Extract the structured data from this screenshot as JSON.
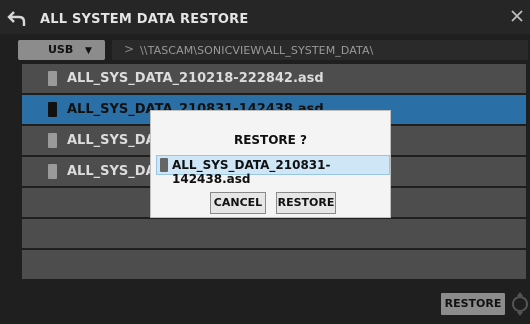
{
  "title": "ALL SYSTEM DATA RESTORE",
  "toolbar": {
    "usb_label": "USB",
    "dropdown_arrow": "▼",
    "path_separator": ">",
    "path": "\\\\TASCAM\\SONICVIEW\\ALL_SYSTEM_DATA\\"
  },
  "files": [
    {
      "name": "ALL_SYS_DATA_210218-222842.asd",
      "selected": false
    },
    {
      "name": "ALL_SYS_DATA_210831-142438.asd",
      "selected": true
    },
    {
      "name": "ALL_SYS_DAT",
      "selected": false
    },
    {
      "name": "ALL_SYS_DAT",
      "selected": false
    },
    {
      "name": "",
      "selected": false
    },
    {
      "name": "",
      "selected": false
    },
    {
      "name": "",
      "selected": false
    }
  ],
  "footer": {
    "restore_label": "RESTORE"
  },
  "dialog": {
    "title": "RESTORE ?",
    "file": "ALL_SYS_DATA_210831-142438.asd",
    "cancel_label": "CANCEL",
    "restore_label": "RESTORE"
  },
  "colors": {
    "background": "#1f1f1f",
    "row": "#4d4d4d",
    "selected_row": "#2a6fa6",
    "dialog": "#f4f4f4",
    "dialog_highlight": "#cfe6f7"
  },
  "icons": {
    "back": "back-arrow-icon",
    "close": "close-icon",
    "file": "file-icon",
    "knob": "knob-icon"
  }
}
